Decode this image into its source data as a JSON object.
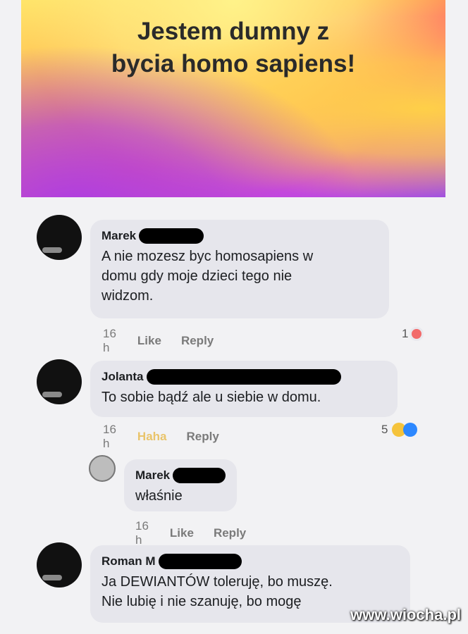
{
  "banner": {
    "line1": "Jestem dumny z",
    "line2": "bycia homo sapiens!"
  },
  "comments": [
    {
      "author": "Marek",
      "lines": [
        "A nie mozesz byc homosapiens w",
        "domu gdy moje dzieci tego nie",
        "widzom."
      ],
      "time": "16 h",
      "reaction_action": "Like",
      "reply": "Reply",
      "react_count": "1"
    },
    {
      "author": "Jolanta",
      "lines": [
        "To sobie bądź ale u siebie w domu."
      ],
      "time": "16 h",
      "reaction_action": "Haha",
      "reply": "Reply",
      "react_count": "5"
    },
    {
      "author": "Marek",
      "lines": [
        "właśnie"
      ],
      "time": "16 h",
      "reaction_action": "Like",
      "reply": "Reply"
    },
    {
      "author": "Roman M",
      "lines": [
        "Ja DEWIANTÓW toleruję, bo muszę.",
        "Nie lubię i nie szanuję, bo mogę"
      ]
    }
  ],
  "watermark": "www.wiocha.pl",
  "colors": {
    "bubble": "#e6e6ec",
    "background": "#f2f2f4",
    "haha_label": "#e9c46a"
  }
}
